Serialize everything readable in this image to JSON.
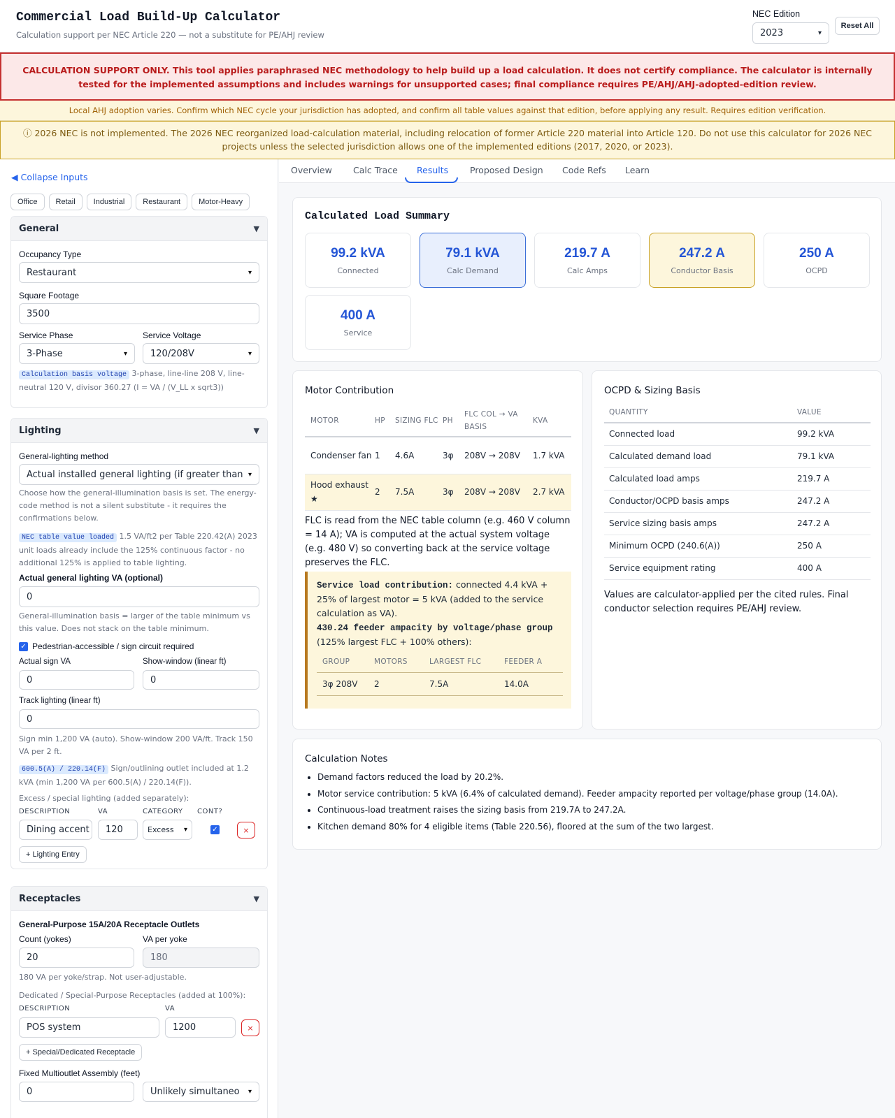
{
  "header": {
    "title": "Commercial Load Build-Up Calculator",
    "subtitle": "Calculation support per NEC Article 220 — not a substitute for PE/AHJ review",
    "edition_label": "NEC Edition",
    "edition_value": "2023",
    "reset_label": "Reset All"
  },
  "banners": {
    "red": "CALCULATION SUPPORT ONLY. This tool applies paraphrased NEC methodology to help build up a load calculation. It does not certify compliance. The calculator is internally tested for the implemented assumptions and includes warnings for unsupported cases; final compliance requires PE/AHJ/AHJ-adopted-edition review.",
    "amber": "Local AHJ adoption varies. Confirm which NEC cycle your jurisdiction has adopted, and confirm all table values against that edition, before applying any result. Requires edition verification.",
    "amber2_icon": "ⓘ",
    "amber2": "2026 NEC is not implemented. The 2026 NEC reorganized load-calculation material, including relocation of former Article 220 material into Article 120. Do not use this calculator for 2026 NEC projects unless the selected jurisdiction allows one of the implemented editions (2017, 2020, or 2023)."
  },
  "inputs": {
    "collapse_label": "◀ Collapse Inputs",
    "presets": [
      "Office",
      "Retail",
      "Industrial",
      "Restaurant",
      "Motor-Heavy"
    ],
    "general": {
      "heading": "General",
      "occupancy_label": "Occupancy Type",
      "occupancy_value": "Restaurant",
      "sqft_label": "Square Footage",
      "sqft_value": "3500",
      "phase_label": "Service Phase",
      "phase_value": "3-Phase",
      "voltage_label": "Service Voltage",
      "voltage_value": "120/208V",
      "basis_tag": "Calculation basis voltage",
      "basis_text": "3-phase, line-line 208 V, line-neutral 120 V, divisor 360.27 (I = VA / (V_LL x sqrt3))"
    },
    "lighting": {
      "heading": "Lighting",
      "method_label": "General-lighting method",
      "method_value": "Actual installed general lighting (if greater than",
      "method_help": "Choose how the general-illumination basis is set. The energy-code method is not a silent substitute - it requires the confirmations below.",
      "table_tag": "NEC table value loaded",
      "table_text": "1.5 VA/ft2 per Table 220.42(A) 2023 unit loads already include the 125% continuous factor - no additional 125% is applied to table lighting.",
      "actual_label": "Actual general lighting VA (optional)",
      "actual_value": "0",
      "actual_help": "General-illumination basis = larger of the table minimum vs this value. Does not stack on the table minimum.",
      "sign_check_label": "Pedestrian-accessible / sign circuit required",
      "sign_va_label": "Actual sign VA",
      "sign_va_value": "0",
      "show_window_label": "Show-window (linear ft)",
      "show_window_value": "0",
      "track_label": "Track lighting (linear ft)",
      "track_value": "0",
      "track_help": "Sign min 1,200 VA (auto). Show-window 200 VA/ft. Track 150 VA per 2 ft.",
      "sign_tag": "600.5(A) / 220.14(F)",
      "sign_text": "Sign/outlining outlet included at 1.2 kVA (min 1,200 VA per 600.5(A) / 220.14(F)).",
      "excess_label": "Excess / special lighting (added separately):",
      "excess_cols": [
        "DESCRIPTION",
        "VA",
        "CATEGORY",
        "CONT?"
      ],
      "excess_row": {
        "description": "Dining accent",
        "va": "120",
        "category": "Excess"
      },
      "remove_label": "×",
      "add_label": "+ Lighting Entry"
    },
    "receptacles": {
      "heading": "Receptacles",
      "gp_label": "General-Purpose 15A/20A Receptacle Outlets",
      "count_label": "Count (yokes)",
      "count_value": "20",
      "va_label": "VA per yoke",
      "va_value": "180",
      "va_help": "180 VA per yoke/strap. Not user-adjustable.",
      "dedicated_label": "Dedicated / Special-Purpose Receptacles (added at 100%):",
      "dedicated_cols": [
        "DESCRIPTION",
        "VA"
      ],
      "dedicated_row": {
        "description": "POS system",
        "va": "1200"
      },
      "remove_label": "×",
      "add_label": "+ Special/Dedicated Receptacle",
      "multi_label": "Fixed Multioutlet Assembly (feet)",
      "multi_value": "0",
      "multi_select": "Unlikely simultaneo"
    }
  },
  "tabs": [
    "Overview",
    "Calc Trace",
    "Results",
    "Proposed Design",
    "Code Refs",
    "Learn"
  ],
  "summary": {
    "title": "Calculated Load Summary",
    "metrics": [
      {
        "value": "99.2 kVA",
        "label": "Connected"
      },
      {
        "value": "79.1 kVA",
        "label": "Calc Demand"
      },
      {
        "value": "219.7 A",
        "label": "Calc Amps"
      },
      {
        "value": "247.2 A",
        "label": "Conductor Basis"
      },
      {
        "value": "250 A",
        "label": "OCPD"
      },
      {
        "value": "400 A",
        "label": "Service"
      }
    ]
  },
  "motor": {
    "title": "Motor Contribution",
    "cols": [
      "MOTOR",
      "HP",
      "SIZING FLC",
      "PH",
      "FLC COL → VA BASIS",
      "KVA"
    ],
    "rows": [
      [
        "Condenser fan",
        "1",
        "4.6A",
        "3φ",
        "208V → 208V",
        "1.7 kVA"
      ],
      [
        "Hood exhaust ★",
        "2",
        "7.5A",
        "3φ",
        "208V → 208V",
        "2.7 kVA"
      ]
    ],
    "flc_note": "FLC is read from the NEC table column (e.g. 460 V column = 14 A); VA is computed at the actual system voltage (e.g. 480 V) so converting back at the service voltage preserves the FLC.",
    "svc_bold": "Service load contribution:",
    "svc_text": "connected 4.4 kVA + 25% of largest motor = 5 kVA (added to the service calculation as VA).",
    "feeder_bold": "430.24 feeder ampacity by voltage/phase group",
    "feeder_text": "(125% largest FLC + 100% others):",
    "group_cols": [
      "GROUP",
      "MOTORS",
      "LARGEST FLC",
      "FEEDER A"
    ],
    "group_row": [
      "3φ 208V",
      "2",
      "7.5A",
      "14.0A"
    ]
  },
  "ocpd": {
    "title": "OCPD & Sizing Basis",
    "cols": [
      "QUANTITY",
      "VALUE"
    ],
    "rows": [
      [
        "Connected load",
        "99.2 kVA"
      ],
      [
        "Calculated demand load",
        "79.1 kVA"
      ],
      [
        "Calculated load amps",
        "219.7 A"
      ],
      [
        "Conductor/OCPD basis amps",
        "247.2 A"
      ],
      [
        "Service sizing basis amps",
        "247.2 A"
      ],
      [
        "Minimum OCPD (240.6(A))",
        "250 A"
      ],
      [
        "Service equipment rating",
        "400 A"
      ]
    ],
    "footnote": "Values are calculator-applied per the cited rules. Final conductor selection requires PE/AHJ review."
  },
  "notes": {
    "title": "Calculation Notes",
    "items": [
      "Demand factors reduced the load by 20.2%.",
      "Motor service contribution: 5 kVA (6.4% of calculated demand). Feeder ampacity reported per voltage/phase group (14.0A).",
      "Continuous-load treatment raises the sizing basis from 219.7A to 247.2A.",
      "Kitchen demand 80% for 4 eligible items (Table 220.56), floored at the sum of the two largest."
    ]
  }
}
